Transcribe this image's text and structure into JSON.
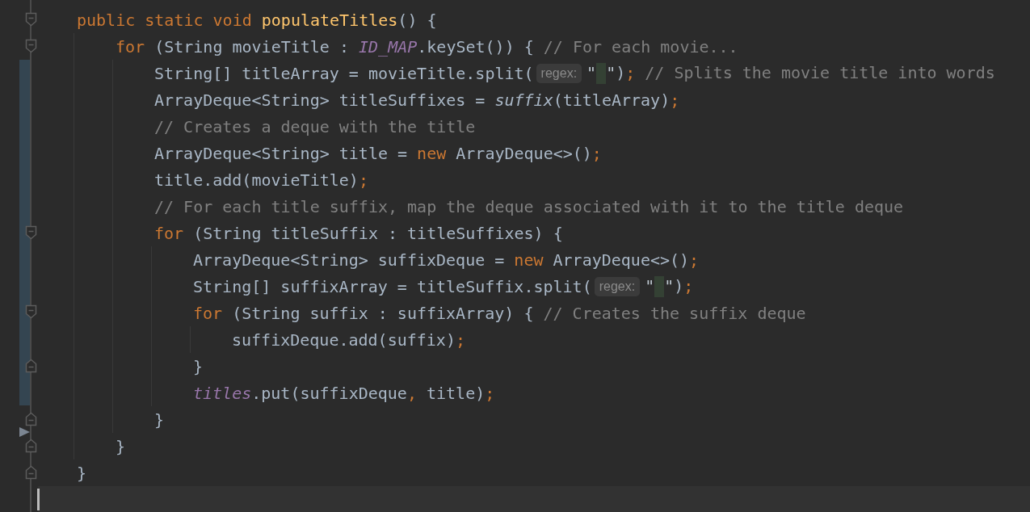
{
  "editor": {
    "gutter": [
      {
        "kind": "fold-start",
        "changed": false,
        "arrow": false
      },
      {
        "kind": "fold-start",
        "changed": false,
        "arrow": false
      },
      {
        "kind": "plain",
        "changed": true,
        "arrow": false
      },
      {
        "kind": "plain",
        "changed": true,
        "arrow": false
      },
      {
        "kind": "plain",
        "changed": true,
        "arrow": false
      },
      {
        "kind": "plain",
        "changed": true,
        "arrow": false
      },
      {
        "kind": "plain",
        "changed": true,
        "arrow": false
      },
      {
        "kind": "plain",
        "changed": true,
        "arrow": false
      },
      {
        "kind": "fold-start",
        "changed": true,
        "arrow": false
      },
      {
        "kind": "plain",
        "changed": true,
        "arrow": false
      },
      {
        "kind": "plain",
        "changed": true,
        "arrow": false
      },
      {
        "kind": "fold-start",
        "changed": true,
        "arrow": false
      },
      {
        "kind": "plain",
        "changed": true,
        "arrow": false
      },
      {
        "kind": "fold-end",
        "changed": true,
        "arrow": false
      },
      {
        "kind": "plain",
        "changed": true,
        "arrow": false
      },
      {
        "kind": "fold-end",
        "changed": false,
        "arrow": false
      },
      {
        "kind": "fold-end",
        "changed": false,
        "arrow": true
      },
      {
        "kind": "fold-end",
        "changed": false,
        "arrow": false
      },
      {
        "kind": "plain",
        "changed": false,
        "arrow": false
      }
    ],
    "code": [
      {
        "kind": "block",
        "open": [
          {
            "text": "public static void ",
            "kind": "keyword"
          },
          {
            "text": "populateTitles",
            "kind": "declaration"
          },
          {
            "text": "() {",
            "kind": "plain"
          }
        ],
        "children": [
          {
            "kind": "block",
            "open": [
              {
                "text": "for",
                "kind": "keyword"
              },
              {
                "text": " (String movieTitle : ",
                "kind": "plain"
              },
              {
                "text": "ID_MAP",
                "kind": "field"
              },
              {
                "text": ".keySet()) { ",
                "kind": "plain"
              },
              {
                "text": "// For each movie...",
                "kind": "comment"
              }
            ],
            "children": [
              {
                "kind": "line",
                "tokens": [
                  {
                    "text": "String[] titleArray = movieTitle.split(",
                    "kind": "plain"
                  },
                  {
                    "text": "regex:",
                    "kind": "hint"
                  },
                  {
                    "text": "\"",
                    "kind": "string"
                  },
                  {
                    "kind": "space-highlight"
                  },
                  {
                    "text": "\"",
                    "kind": "string"
                  },
                  {
                    "text": ")",
                    "kind": "plain"
                  },
                  {
                    "text": ";",
                    "kind": "punct"
                  },
                  {
                    "text": " // Splits the movie title into words",
                    "kind": "comment"
                  }
                ]
              },
              {
                "kind": "line",
                "tokens": [
                  {
                    "text": "ArrayDeque<String> titleSuffixes = ",
                    "kind": "plain"
                  },
                  {
                    "text": "suffix",
                    "kind": "static-call"
                  },
                  {
                    "text": "(titleArray)",
                    "kind": "plain"
                  },
                  {
                    "text": ";",
                    "kind": "punct"
                  }
                ]
              },
              {
                "kind": "line",
                "tokens": [
                  {
                    "text": "// Creates a deque with the title",
                    "kind": "comment"
                  }
                ]
              },
              {
                "kind": "line",
                "tokens": [
                  {
                    "text": "ArrayDeque<String> title = ",
                    "kind": "plain"
                  },
                  {
                    "text": "new",
                    "kind": "keyword"
                  },
                  {
                    "text": " ArrayDeque<>()",
                    "kind": "plain"
                  },
                  {
                    "text": ";",
                    "kind": "punct"
                  }
                ]
              },
              {
                "kind": "line",
                "tokens": [
                  {
                    "text": "title.add(movieTitle)",
                    "kind": "plain"
                  },
                  {
                    "text": ";",
                    "kind": "punct"
                  }
                ]
              },
              {
                "kind": "line",
                "tokens": [
                  {
                    "text": "// For each title suffix, map the deque associated with it to the title deque",
                    "kind": "comment"
                  }
                ]
              },
              {
                "kind": "block",
                "open": [
                  {
                    "text": "for",
                    "kind": "keyword"
                  },
                  {
                    "text": " (String titleSuffix : titleSuffixes) {",
                    "kind": "plain"
                  }
                ],
                "children": [
                  {
                    "kind": "line",
                    "tokens": [
                      {
                        "text": "ArrayDeque<String> suffixDeque = ",
                        "kind": "plain"
                      },
                      {
                        "text": "new",
                        "kind": "keyword"
                      },
                      {
                        "text": " ArrayDeque<>()",
                        "kind": "plain"
                      },
                      {
                        "text": ";",
                        "kind": "punct"
                      }
                    ]
                  },
                  {
                    "kind": "line",
                    "tokens": [
                      {
                        "text": "String[] suffixArray = titleSuffix.split(",
                        "kind": "plain"
                      },
                      {
                        "text": "regex:",
                        "kind": "hint"
                      },
                      {
                        "text": "\"",
                        "kind": "string"
                      },
                      {
                        "kind": "space-highlight"
                      },
                      {
                        "text": "\"",
                        "kind": "string"
                      },
                      {
                        "text": ")",
                        "kind": "plain"
                      },
                      {
                        "text": ";",
                        "kind": "punct"
                      }
                    ]
                  },
                  {
                    "kind": "block",
                    "open": [
                      {
                        "text": "for",
                        "kind": "keyword"
                      },
                      {
                        "text": " (String suffix : suffixArray) { ",
                        "kind": "plain"
                      },
                      {
                        "text": "// Creates the suffix deque",
                        "kind": "comment"
                      }
                    ],
                    "children": [
                      {
                        "kind": "line",
                        "tokens": [
                          {
                            "text": "suffixDeque.add(suffix)",
                            "kind": "plain"
                          },
                          {
                            "text": ";",
                            "kind": "punct"
                          }
                        ]
                      }
                    ],
                    "close": [
                      {
                        "text": "}",
                        "kind": "plain"
                      }
                    ]
                  },
                  {
                    "kind": "line",
                    "tokens": [
                      {
                        "text": "titles",
                        "kind": "field"
                      },
                      {
                        "text": ".put(suffixDeque",
                        "kind": "plain"
                      },
                      {
                        "text": ",",
                        "kind": "punct"
                      },
                      {
                        "text": " title)",
                        "kind": "plain"
                      },
                      {
                        "text": ";",
                        "kind": "punct"
                      }
                    ]
                  }
                ],
                "close": [
                  {
                    "text": "}",
                    "kind": "plain"
                  }
                ]
              }
            ],
            "close": [
              {
                "text": "}",
                "kind": "plain"
              }
            ]
          }
        ],
        "close": [
          {
            "text": "}",
            "kind": "plain"
          }
        ]
      },
      {
        "kind": "line",
        "current": true
      }
    ]
  }
}
